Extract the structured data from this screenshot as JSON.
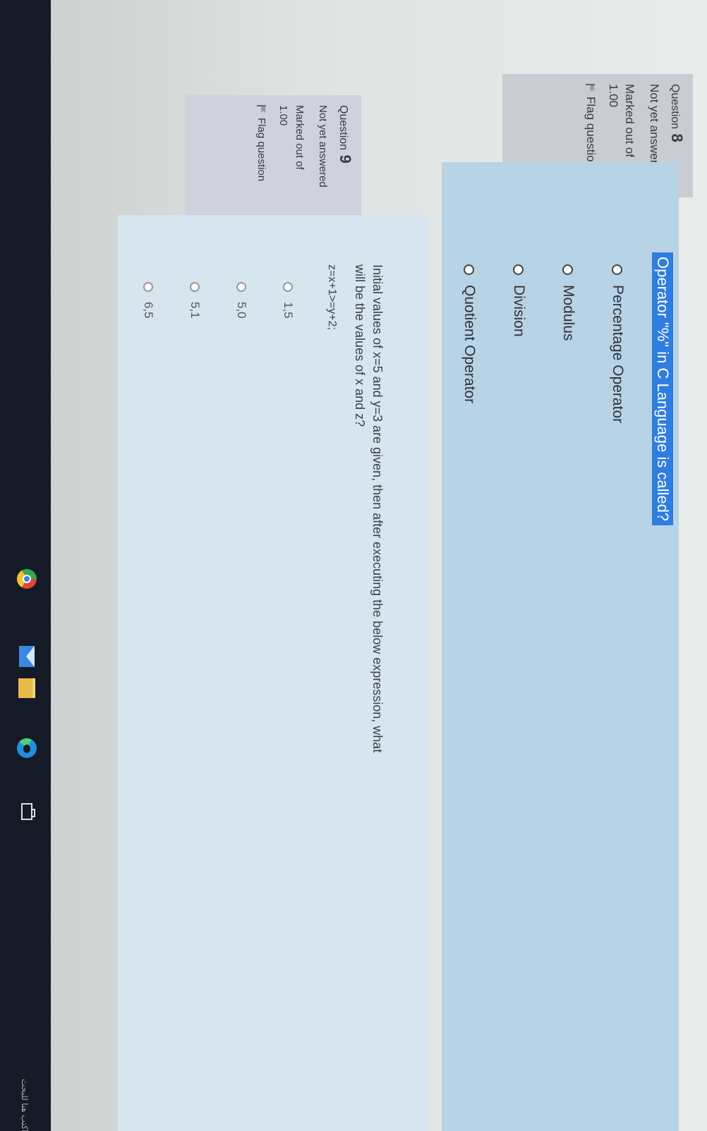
{
  "q8": {
    "number_label": "Question",
    "number": "8",
    "status": "Not yet answered",
    "marked_label": "Marked out of",
    "marked_value": "1.00",
    "flag_label": "Flag question",
    "text": "Operator \"%\" in C Language is called?",
    "options": [
      "Percentage Operator",
      "Modulus",
      "Division",
      "Quotient Operator"
    ]
  },
  "q9": {
    "number_label": "Question",
    "number": "9",
    "status": "Not yet answered",
    "marked_label": "Marked out of",
    "marked_value": "1.00",
    "flag_label": "Flag question",
    "text_line1": "Initial values of x=5 and y=3 are given, then after executing the below expression, what",
    "text_line2": "will be the values of x and z?",
    "expression": "z=x+1>=y+2;",
    "options": [
      "1,5",
      "5,0",
      "5,1",
      "6,5"
    ]
  },
  "taskbar": {
    "search_text": "اكتب هنا للبحث",
    "icons": [
      "chrome-icon",
      "mail-icon",
      "folder-icon",
      "edge-icon",
      "task-view-icon"
    ]
  }
}
